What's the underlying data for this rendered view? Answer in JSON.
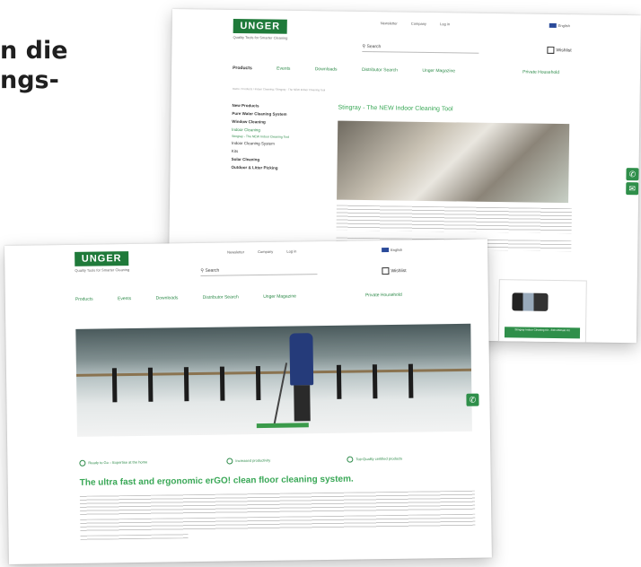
{
  "headline": {
    "line1": "n die",
    "line2": "ngs-"
  },
  "back_page": {
    "logo": "UNGER",
    "tagline": "Quality Tools for Smarter Cleaning",
    "top_links": [
      "Newsletter",
      "Company",
      "Log in"
    ],
    "language": "English",
    "search_placeholder": "Search",
    "wishlist": "Wishlist",
    "nav": [
      "Products",
      "Events",
      "Downloads",
      "Distributor Search",
      "Unger Magazine"
    ],
    "private_household": "Private Household",
    "breadcrumb": "Home / Products / Indoor Cleaning / Stingray - The NEW Indoor Cleaning Tool",
    "sidebar": [
      {
        "label": "New Products",
        "style": "strong"
      },
      {
        "label": "Pure Water Cleaning System",
        "style": "strong"
      },
      {
        "label": "Window Cleaning",
        "style": "strong"
      },
      {
        "label": "Indoor Cleaning",
        "style": "green"
      },
      {
        "label": "Stingray - The NEW Indoor Cleaning Tool",
        "style": "small"
      },
      {
        "label": "Indoor Cleaning System",
        "style": "plain"
      },
      {
        "label": "Kits",
        "style": "plain"
      },
      {
        "label": "Solar Cleaning",
        "style": "strong"
      },
      {
        "label": "Outdoor & Litter Picking",
        "style": "strong"
      }
    ],
    "page_title": "Stingray - The NEW Indoor Cleaning Tool",
    "card_button": "Stingray Indoor Cleaning Kit - 330 Ultimate Kit",
    "phone_icon": "phone-icon"
  },
  "front_page": {
    "logo": "UNGER",
    "tagline": "Quality Tools for Smarter Cleaning",
    "top_links": [
      "Newsletter",
      "Company",
      "Log in"
    ],
    "language": "English",
    "search_placeholder": "Search",
    "wishlist": "Wishlist",
    "nav": [
      "Products",
      "Events",
      "Downloads",
      "Distributor Search",
      "Unger Magazine"
    ],
    "private_household": "Private Household",
    "bullets": [
      "Ready to Go – Expertise at the home",
      "Increased productivity",
      "Top-Quality certified products"
    ],
    "feature_title": "The ultra fast and ergonomic erGO! clean floor cleaning system.",
    "phone_icon": "phone-icon"
  }
}
